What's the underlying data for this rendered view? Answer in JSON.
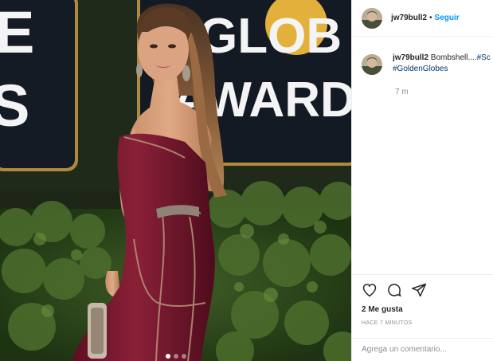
{
  "post": {
    "image": {
      "description": "photo",
      "sign_top": "GLOB",
      "sign_bottom": "AWARD",
      "sign_left_top": "E",
      "sign_left_bottom": "S",
      "carousel_dots": 3,
      "active_dot": 0
    },
    "header": {
      "username": "jw79bull2",
      "separator": "•",
      "follow_label": "Seguir"
    },
    "caption": {
      "username": "jw79bull2",
      "text": "Bombshell....",
      "hashtag_1": "#Sc",
      "hashtag_2": "#GoldenGlobes",
      "time_ago": "7 m"
    },
    "actions": {
      "icons": [
        "heart-icon",
        "comment-icon",
        "share-icon"
      ],
      "likes": "2 Me gusta",
      "date": "HACE 7 MINUTOS",
      "comment_placeholder": "Agrega un comentario..."
    }
  },
  "colors": {
    "link": "#0095f6",
    "hashtag": "#00376b",
    "muted": "#8e8e8e",
    "border": "#efefef"
  }
}
